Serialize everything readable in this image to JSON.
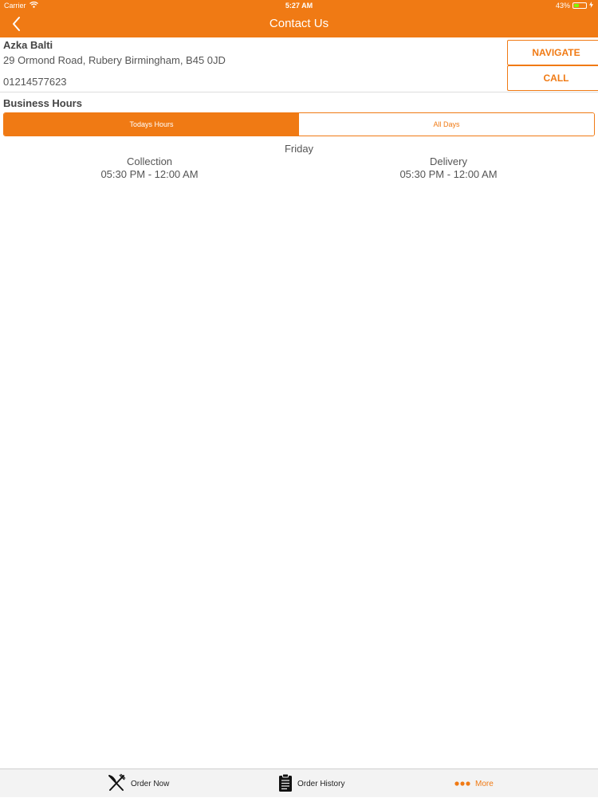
{
  "status_bar": {
    "carrier": "Carrier",
    "time": "5:27 AM",
    "battery_percent": "43%",
    "battery_level": 0.43
  },
  "nav": {
    "title": "Contact Us",
    "back_icon": "chevron-left-icon"
  },
  "contact": {
    "name": "Azka Balti",
    "address": "29 Ormond Road, Rubery Birmingham, B45 0JD",
    "phone": "01214577623",
    "navigate_label": "NAVIGATE",
    "call_label": "CALL"
  },
  "business_hours": {
    "title": "Business Hours",
    "tabs": [
      {
        "label": "Todays Hours",
        "selected": true
      },
      {
        "label": "All Days",
        "selected": false
      }
    ],
    "day": "Friday",
    "collection": {
      "label": "Collection",
      "hours": "05:30 PM - 12:00 AM"
    },
    "delivery": {
      "label": "Delivery",
      "hours": "05:30 PM - 12:00 AM"
    }
  },
  "tab_bar": {
    "items": [
      {
        "label": "Order Now",
        "icon": "fork-knife-icon"
      },
      {
        "label": "Order History",
        "icon": "clipboard-icon"
      },
      {
        "label": "More",
        "icon": "more-dots-icon",
        "active": true
      }
    ]
  },
  "colors": {
    "accent": "#F07A14",
    "battery": "#7CFC00"
  }
}
